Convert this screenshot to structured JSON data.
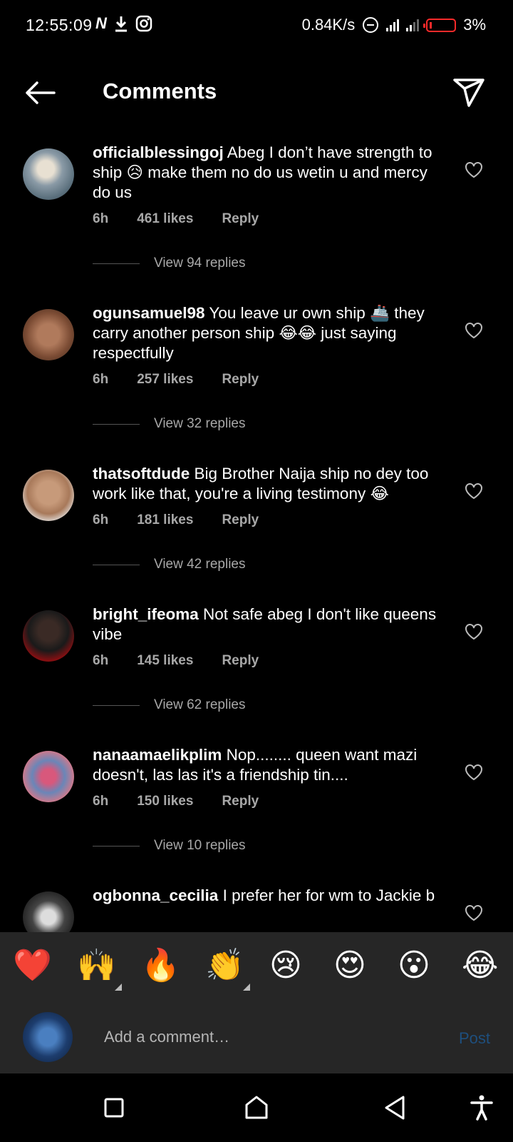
{
  "status_bar": {
    "time": "12:55:09",
    "net_speed": "0.84K/s",
    "battery": "3%",
    "icons": [
      "n-icon",
      "download-icon",
      "instagram-icon",
      "dnd-icon",
      "signal-icon",
      "signal-icon",
      "battery-icon"
    ]
  },
  "header": {
    "title": "Comments"
  },
  "comments": [
    {
      "user": "officialblessingoj",
      "text": "Abeg I don’t have strength to ship 😥 make them no do us wetin u and mercy do us",
      "age": "6h",
      "likes": "461 likes",
      "reply": "Reply",
      "view_replies": "View 94 replies"
    },
    {
      "user": "ogunsamuel98",
      "text": "You leave ur own ship 🚢 they carry another person ship 😂😂 just saying respectfully",
      "age": "6h",
      "likes": "257 likes",
      "reply": "Reply",
      "view_replies": "View 32 replies"
    },
    {
      "user": "thatsoftdude",
      "text": "Big Brother Naija ship no dey too work like that, you're a living testimony 😂",
      "age": "6h",
      "likes": "181 likes",
      "reply": "Reply",
      "view_replies": "View 42 replies"
    },
    {
      "user": "bright_ifeoma",
      "text": "Not safe abeg I don't like queens vibe",
      "age": "6h",
      "likes": "145 likes",
      "reply": "Reply",
      "view_replies": "View 62 replies"
    },
    {
      "user": "nanaamaelikplim",
      "text": "Nop........ queen want mazi doesn't, las las it's a friendship tin....",
      "age": "6h",
      "likes": "150 likes",
      "reply": "Reply",
      "view_replies": "View 10 replies"
    },
    {
      "user": "ogbonna_cecilia",
      "text": "I prefer her for wm to Jackie b"
    }
  ],
  "emoji_bar": [
    "❤️",
    "🙌",
    "🔥",
    "👏",
    "😢",
    "😍",
    "😮",
    "😂"
  ],
  "input": {
    "placeholder": "Add a comment…",
    "post_label": "Post"
  },
  "colors": {
    "background": "#000000",
    "bar": "#262626",
    "muted": "#a8a8a8",
    "post": "#1e4f7e",
    "battery": "#ff2a2a"
  }
}
